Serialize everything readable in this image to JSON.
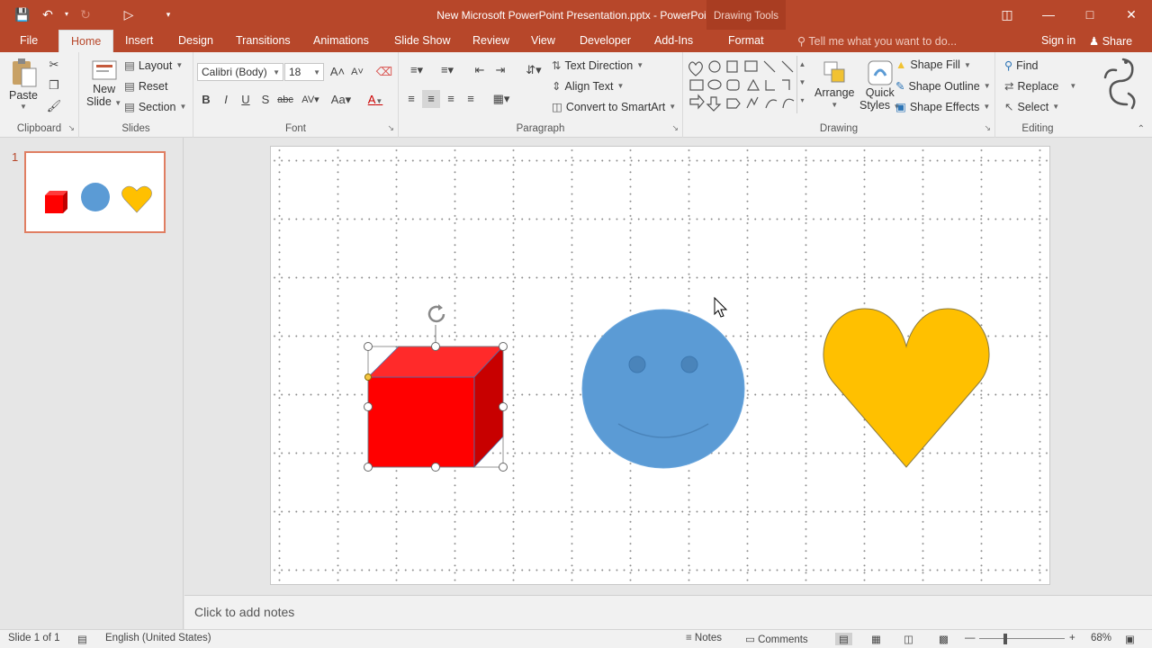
{
  "window": {
    "doc_title": "New Microsoft PowerPoint Presentation.pptx - PowerPoint",
    "context_label": "Drawing Tools"
  },
  "tabs": {
    "file": "File",
    "home": "Home",
    "insert": "Insert",
    "design": "Design",
    "transitions": "Transitions",
    "animations": "Animations",
    "slideshow": "Slide Show",
    "review": "Review",
    "view": "View",
    "developer": "Developer",
    "addins": "Add-Ins",
    "format": "Format"
  },
  "tellme": {
    "placeholder": "Tell me what you want to do..."
  },
  "account": {
    "signin": "Sign in",
    "share": "Share"
  },
  "ribbon": {
    "clipboard": {
      "label": "Clipboard",
      "paste": "Paste"
    },
    "slides": {
      "label": "Slides",
      "new_slide_1": "New",
      "new_slide_2": "Slide",
      "layout": "Layout",
      "reset": "Reset",
      "section": "Section"
    },
    "font": {
      "label": "Font",
      "family": "Calibri (Body)",
      "size": "18"
    },
    "paragraph": {
      "label": "Paragraph",
      "text_direction": "Text Direction",
      "align_text": "Align Text",
      "convert_smartart": "Convert to SmartArt"
    },
    "drawing": {
      "label": "Drawing",
      "arrange": "Arrange",
      "quick_styles_1": "Quick",
      "quick_styles_2": "Styles",
      "shape_fill": "Shape Fill",
      "shape_outline": "Shape Outline",
      "shape_effects": "Shape Effects"
    },
    "editing": {
      "label": "Editing",
      "find": "Find",
      "replace": "Replace",
      "select": "Select"
    }
  },
  "thumbnails": [
    {
      "number": "1"
    }
  ],
  "slide": {
    "shapes": [
      {
        "name": "cube",
        "fill": "#ff0000",
        "selected": true
      },
      {
        "name": "smiley-face",
        "fill": "#5b9bd5"
      },
      {
        "name": "heart",
        "fill": "#ffc000"
      }
    ]
  },
  "notes": {
    "placeholder": "Click to add notes"
  },
  "status": {
    "slide_info": "Slide 1 of 1",
    "language": "English (United States)",
    "notes": "Notes",
    "comments": "Comments",
    "zoom": "68%"
  },
  "colors": {
    "accent": "#b7472a",
    "ribbon_bg": "#f1f1f1"
  }
}
